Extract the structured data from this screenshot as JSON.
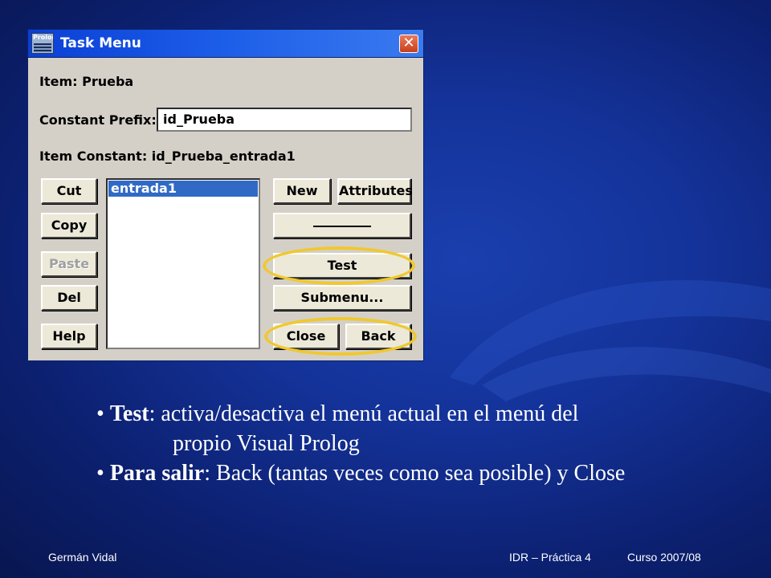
{
  "dialog": {
    "title": "Task Menu",
    "app_icon_text": "Prolog",
    "close_glyph": "✕",
    "item_label": "Item: Prueba",
    "prefix_label": "Constant Prefix:",
    "prefix_value": "id_Prueba",
    "constant_label": "Item Constant: id_Prueba_entrada1",
    "list_items": [
      "entrada1"
    ],
    "buttons": {
      "cut": "Cut",
      "copy": "Copy",
      "paste": "Paste",
      "del": "Del",
      "help": "Help",
      "new": "New",
      "attributes": "Attributes",
      "test": "Test",
      "submenu": "Submenu...",
      "close": "Close",
      "back": "Back"
    },
    "highlight_color": "#f0c830"
  },
  "bullets": [
    {
      "bold": "Test",
      "rest": ": activa/desactiva el menú actual en el menú del"
    },
    {
      "cont": "propio Visual Prolog"
    },
    {
      "bold": "Para salir",
      "rest": ": Back (tantas veces como sea posible) y Close"
    }
  ],
  "footer": {
    "author": "Germán Vidal",
    "course": "IDR – Práctica 4",
    "year": "Curso 2007/08"
  }
}
